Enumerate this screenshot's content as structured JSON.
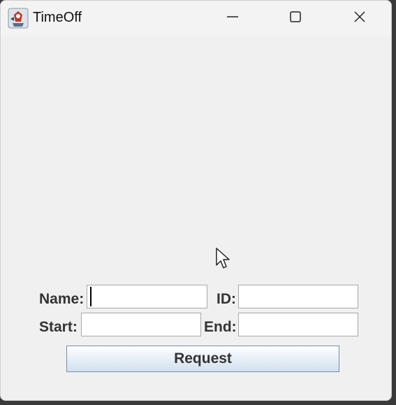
{
  "window": {
    "title": "TimeOff"
  },
  "icons": {
    "app": "java-cup-icon",
    "minimize": "minimize-icon",
    "maximize": "maximize-icon",
    "close": "close-icon",
    "pointer": "mouse-pointer-icon"
  },
  "form": {
    "name_label": "Name:",
    "name_value": "",
    "id_label": "ID:",
    "id_value": "",
    "start_label": "Start:",
    "start_value": "",
    "end_label": "End:",
    "end_value": "",
    "request_label": "Request"
  },
  "colors": {
    "window_bg": "#f0f0f0",
    "button_border": "#7a8ea8",
    "label_text": "#333333"
  }
}
